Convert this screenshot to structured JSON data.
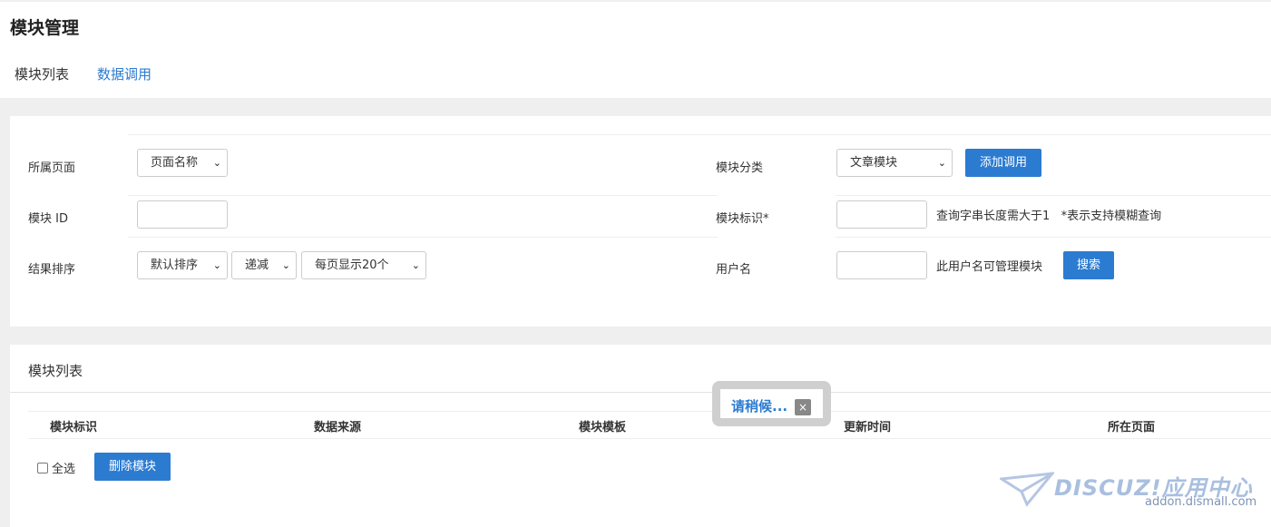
{
  "page": {
    "title": "模块管理"
  },
  "tabs": [
    {
      "label": "模块列表"
    },
    {
      "label": "数据调用"
    }
  ],
  "search": {
    "page_label": "所属页面",
    "page_select": "页面名称",
    "category_label": "模块分类",
    "category_select": "文章模块",
    "add_call_button": "添加调用",
    "module_id_label": "模块 ID",
    "module_mark_label": "模块标识*",
    "mark_hint": "查询字串长度需大于1   *表示支持模糊查询",
    "order_label": "结果排序",
    "order_select": "默认排序",
    "direction_select": "递减",
    "per_page_select": "每页显示20个",
    "username_label": "用户名",
    "username_hint": "此用户名可管理模块",
    "search_button": "搜索"
  },
  "list": {
    "title": "模块列表",
    "columns": [
      "模块标识",
      "数据来源",
      "模块模板",
      "更新时间",
      "所在页面"
    ],
    "select_all_label": "全选",
    "delete_button": "删除模块"
  },
  "loading": {
    "text": "请稍候...",
    "close": "×"
  },
  "watermark": {
    "brand": "DISCUZ!应用中心",
    "domain": "addon.dismall.com"
  },
  "icons": {
    "select_arrow": "chevron-down-icon",
    "loading_close": "close-icon",
    "watermark_logo": "paper-plane-icon"
  }
}
